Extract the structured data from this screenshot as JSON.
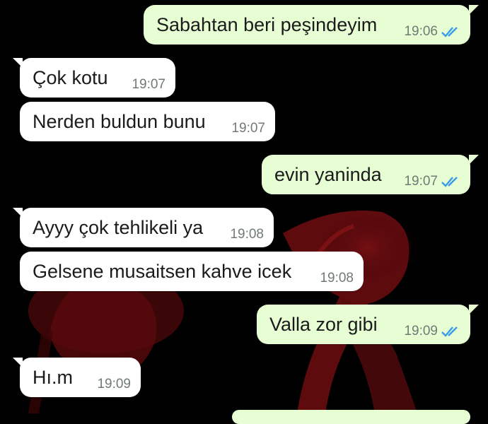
{
  "messages": [
    {
      "direction": "outgoing",
      "text": "Sabahtan beri peşindeyim",
      "time": "19:06",
      "status_icon": "double-check-read-icon"
    },
    {
      "direction": "incoming",
      "text": "Çok kotu",
      "time": "19:07"
    },
    {
      "direction": "incoming",
      "text": "Nerden buldun bunu",
      "time": "19:07"
    },
    {
      "direction": "outgoing",
      "text": "evin yaninda",
      "time": "19:07",
      "status_icon": "double-check-read-icon"
    },
    {
      "direction": "incoming",
      "text": "Ayyy çok tehlikeli ya",
      "time": "19:08"
    },
    {
      "direction": "incoming",
      "text": "Gelsene musaitsen kahve icek",
      "time": "19:08"
    },
    {
      "direction": "outgoing",
      "text": "Valla zor gibi",
      "time": "19:09",
      "status_icon": "double-check-read-icon"
    },
    {
      "direction": "incoming",
      "text": "Hı.m",
      "time": "19:09"
    }
  ],
  "colors": {
    "outgoing_bubble": "#e7fed5",
    "incoming_bubble": "#ffffff",
    "read_tick": "#3a9be6",
    "timestamp": "#6f7b74",
    "background": "#000000",
    "wallpaper_flamingo": "#6e0d10"
  }
}
